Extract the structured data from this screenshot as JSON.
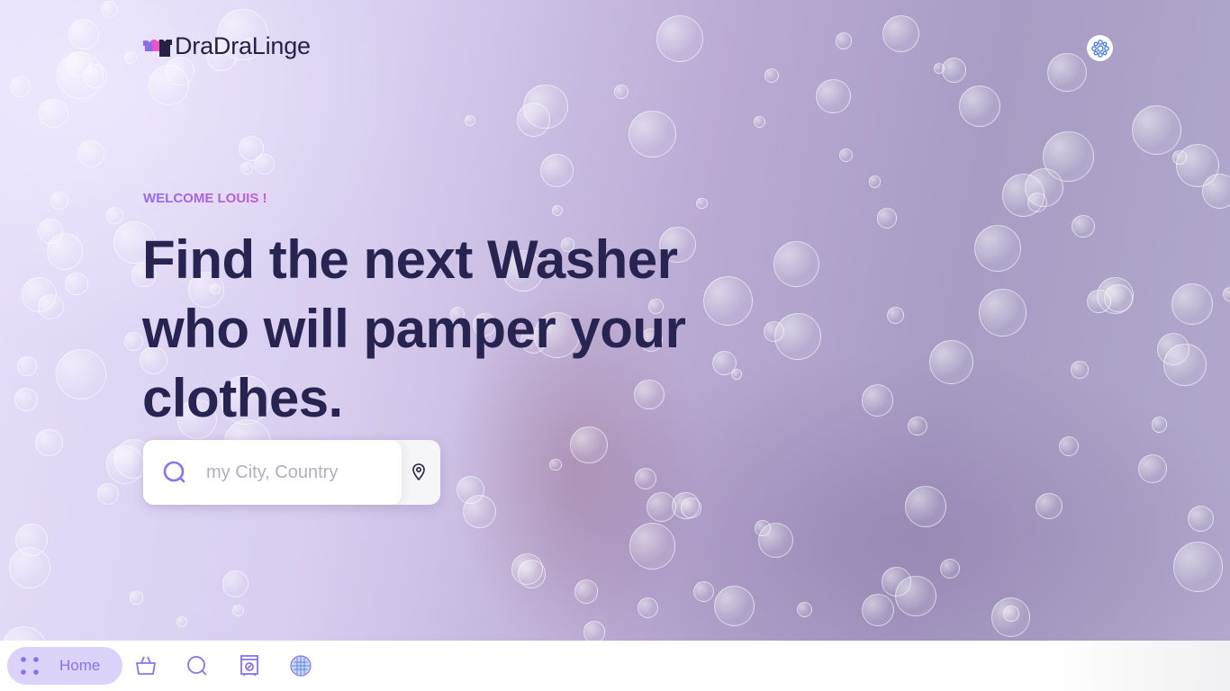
{
  "brand": {
    "name": "DraDraLinge"
  },
  "hero": {
    "welcome": "WELCOME LOUIS !",
    "headline": "Find the next Washer who will pamper your clothes."
  },
  "search": {
    "placeholder": "my City, Country",
    "value": ""
  },
  "nav": {
    "home_label": "Home",
    "items": [
      "home",
      "basket",
      "search",
      "washer",
      "profile"
    ]
  },
  "colors": {
    "accent": "#8b70f0",
    "headline": "#282452",
    "nav_active_bg": "#dcd3fb"
  }
}
